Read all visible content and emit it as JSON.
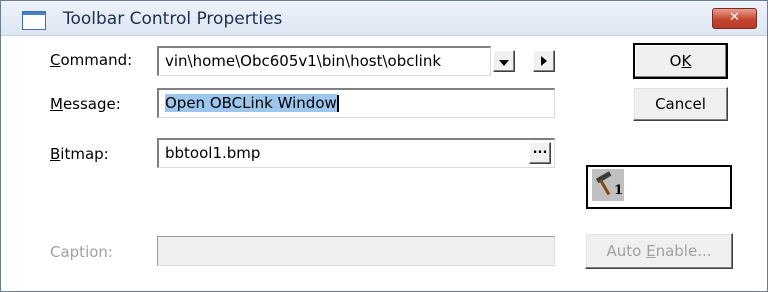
{
  "window": {
    "title": "Toolbar Control Properties",
    "close_label": "✕"
  },
  "command": {
    "label_prefix": "",
    "label_mnemonic": "C",
    "label_suffix": "ommand:",
    "value": "vin\\home\\Obc605v1\\bin\\host\\obclink"
  },
  "message": {
    "label_mnemonic": "M",
    "label_suffix": "essage:",
    "value": "Open OBCLink Window"
  },
  "bitmap": {
    "label_mnemonic": "B",
    "label_suffix": "itmap:",
    "value": "bbtool1.bmp",
    "browse_label": "...",
    "preview_subscript": "1"
  },
  "caption": {
    "label": "Caption:",
    "value": ""
  },
  "buttons": {
    "ok_prefix": "O",
    "ok_mnemonic": "K",
    "cancel": "Cancel",
    "auto_prefix": "Auto ",
    "auto_mnemonic": "E",
    "auto_suffix": "nable..."
  },
  "icons": {
    "preview": "hammer-icon",
    "dropdown": "chevron-down-icon",
    "arrow": "arrow-right-icon"
  }
}
